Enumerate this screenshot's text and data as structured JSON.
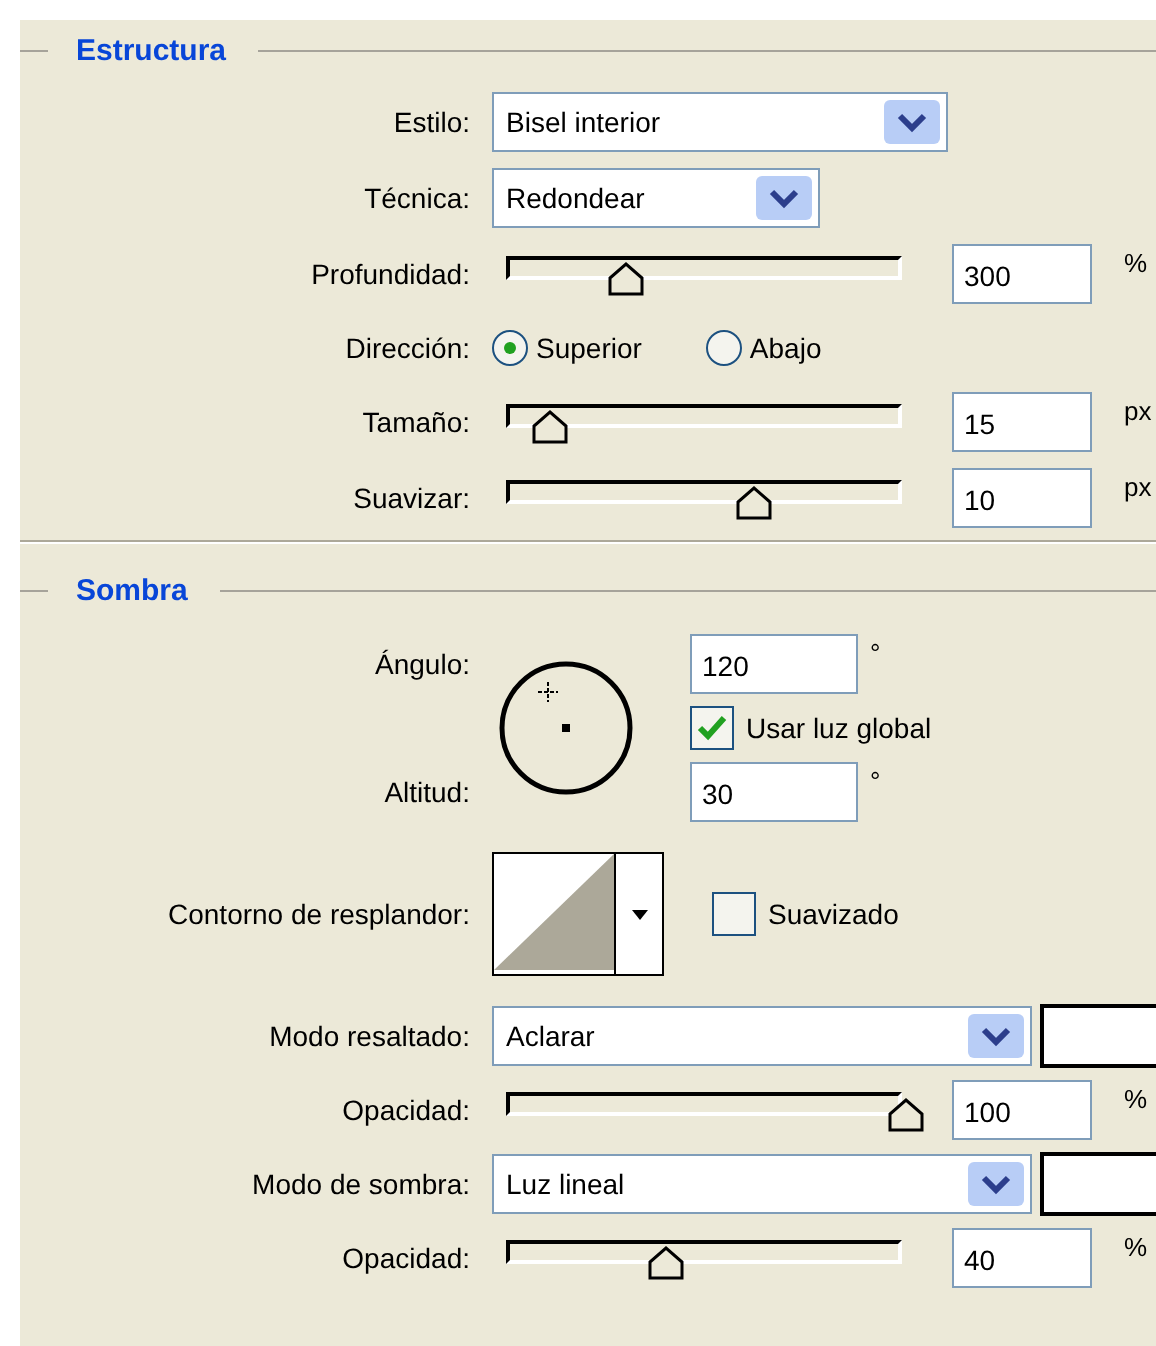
{
  "sections": [
    {
      "title": "Estructura",
      "rows": [
        {
          "kind": "select",
          "label": "Estilo:",
          "value": "Bisel interior"
        },
        {
          "kind": "select",
          "label": "Técnica:",
          "value": "Redondear"
        },
        {
          "kind": "slider",
          "label": "Profundidad:",
          "level": 0.3,
          "value": "300",
          "unit": "%"
        },
        {
          "kind": "radio",
          "label": "Dirección:",
          "options": [
            {
              "label": "Superior",
              "selected": true
            },
            {
              "label": "Abajo",
              "selected": false
            }
          ]
        },
        {
          "kind": "slider",
          "label": "Tamaño:",
          "level": 0.11,
          "value": "15",
          "unit": "px"
        },
        {
          "kind": "slider",
          "label": "Suavizar:",
          "level": 0.62,
          "value": "10",
          "unit": "px"
        }
      ]
    },
    {
      "title": "Sombra",
      "rows": [
        {
          "kind": "angle",
          "angle_label": "Ángulo:",
          "angle_value": "120",
          "angle_unit": "°",
          "altitude_label": "Altitud:",
          "altitude_value": "30",
          "altitude_unit": "°",
          "global_light": {
            "label": "Usar luz global",
            "checked": true
          }
        },
        {
          "kind": "contour",
          "label": "Contorno de resplandor:",
          "antialias": {
            "label": "Suavizado",
            "checked": false
          }
        },
        {
          "kind": "select",
          "label": "Modo resaltado:",
          "value": "Aclarar",
          "color": "#ffffff"
        },
        {
          "kind": "slider",
          "label": "Opacidad:",
          "level": 1.0,
          "value": "100",
          "unit": "%"
        },
        {
          "kind": "select",
          "label": "Modo de sombra:",
          "value": "Luz lineal",
          "color": "#ffffff"
        },
        {
          "kind": "slider",
          "label": "Opacidad:",
          "level": 0.4,
          "value": "40",
          "unit": "%"
        }
      ]
    }
  ]
}
